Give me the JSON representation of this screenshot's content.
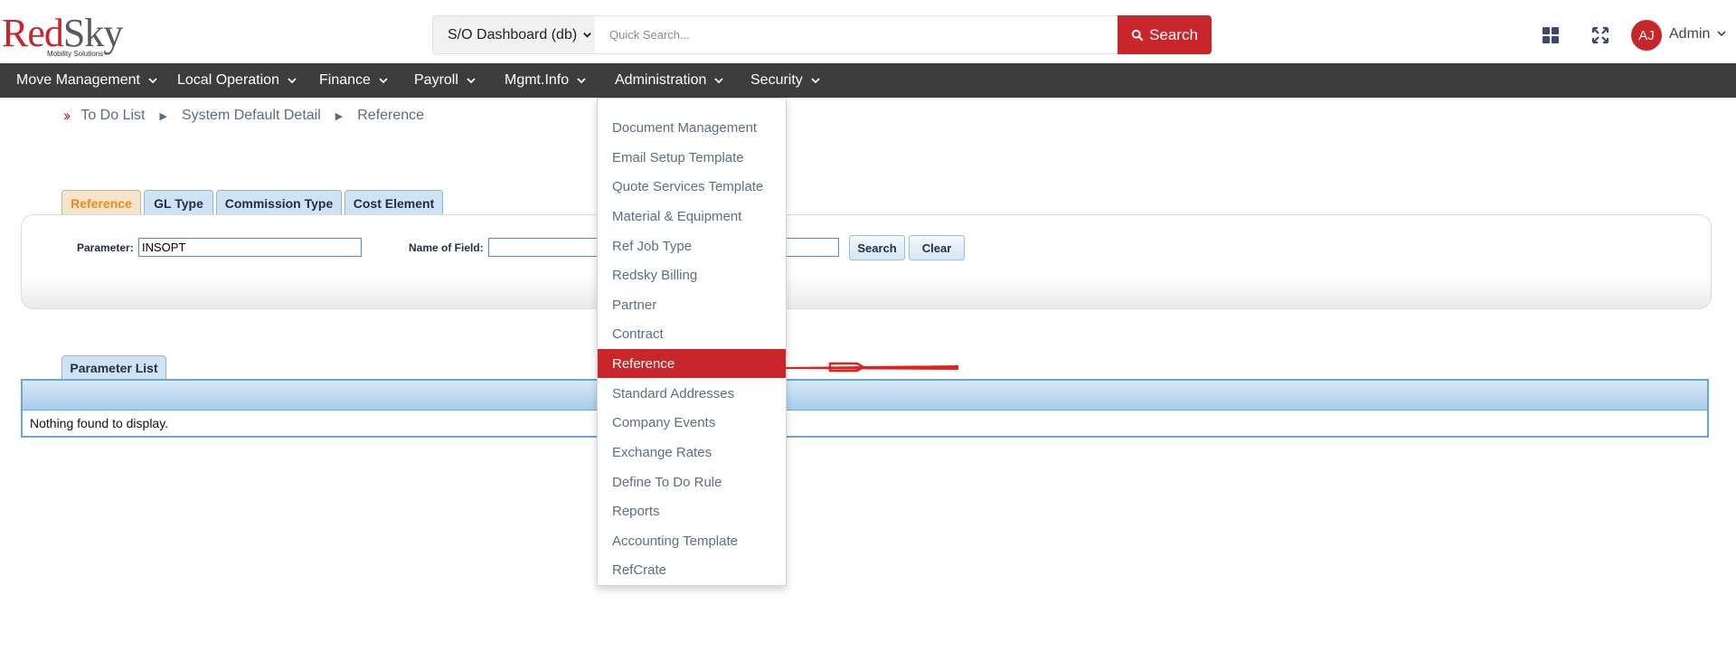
{
  "header": {
    "logo_red": "Red",
    "logo_gray": "Sky",
    "logo_sub": "Mobility Solutions",
    "dashboard_select": "S/O Dashboard (db)",
    "quick_search_placeholder": "Quick Search...",
    "search_button": "Search",
    "avatar_initials": "AJ",
    "user_label": "Admin"
  },
  "nav": {
    "items": [
      {
        "label": "Move Management"
      },
      {
        "label": "Local Operation"
      },
      {
        "label": "Finance"
      },
      {
        "label": "Payroll"
      },
      {
        "label": "Mgmt.Info"
      },
      {
        "label": "Administration"
      },
      {
        "label": "Security"
      }
    ]
  },
  "breadcrumb": {
    "items": [
      "To Do List",
      "System Default Detail",
      "Reference"
    ]
  },
  "tabs": [
    {
      "label": "Reference",
      "active": true
    },
    {
      "label": "GL Type"
    },
    {
      "label": "Commission Type"
    },
    {
      "label": "Cost Element"
    }
  ],
  "filter": {
    "parameter_label": "Parameter:",
    "parameter_value": "INSOPT",
    "name_of_field_label": "Name of Field:",
    "name_of_field_value": "",
    "search_button": "Search",
    "clear_button": "Clear"
  },
  "parameter_list": {
    "tab_label": "Parameter List",
    "empty_message": "Nothing found to display."
  },
  "admin_menu": {
    "items": [
      "Document Management",
      "Email Setup Template",
      "Quote Services Template",
      "Material & Equipment",
      "Ref Job Type",
      "Redsky Billing",
      "Partner",
      "Contract",
      "Reference",
      "Standard Addresses",
      "Company Events",
      "Exchange Rates",
      "Define To Do Rule",
      "Reports",
      "Accounting Template",
      "RefCrate"
    ],
    "selected": "Reference"
  },
  "colors": {
    "brand_red": "#c8262b",
    "nav_bg": "#3d3d3d",
    "tab_active_text": "#f08a16",
    "menu_text": "#5b6f87"
  }
}
